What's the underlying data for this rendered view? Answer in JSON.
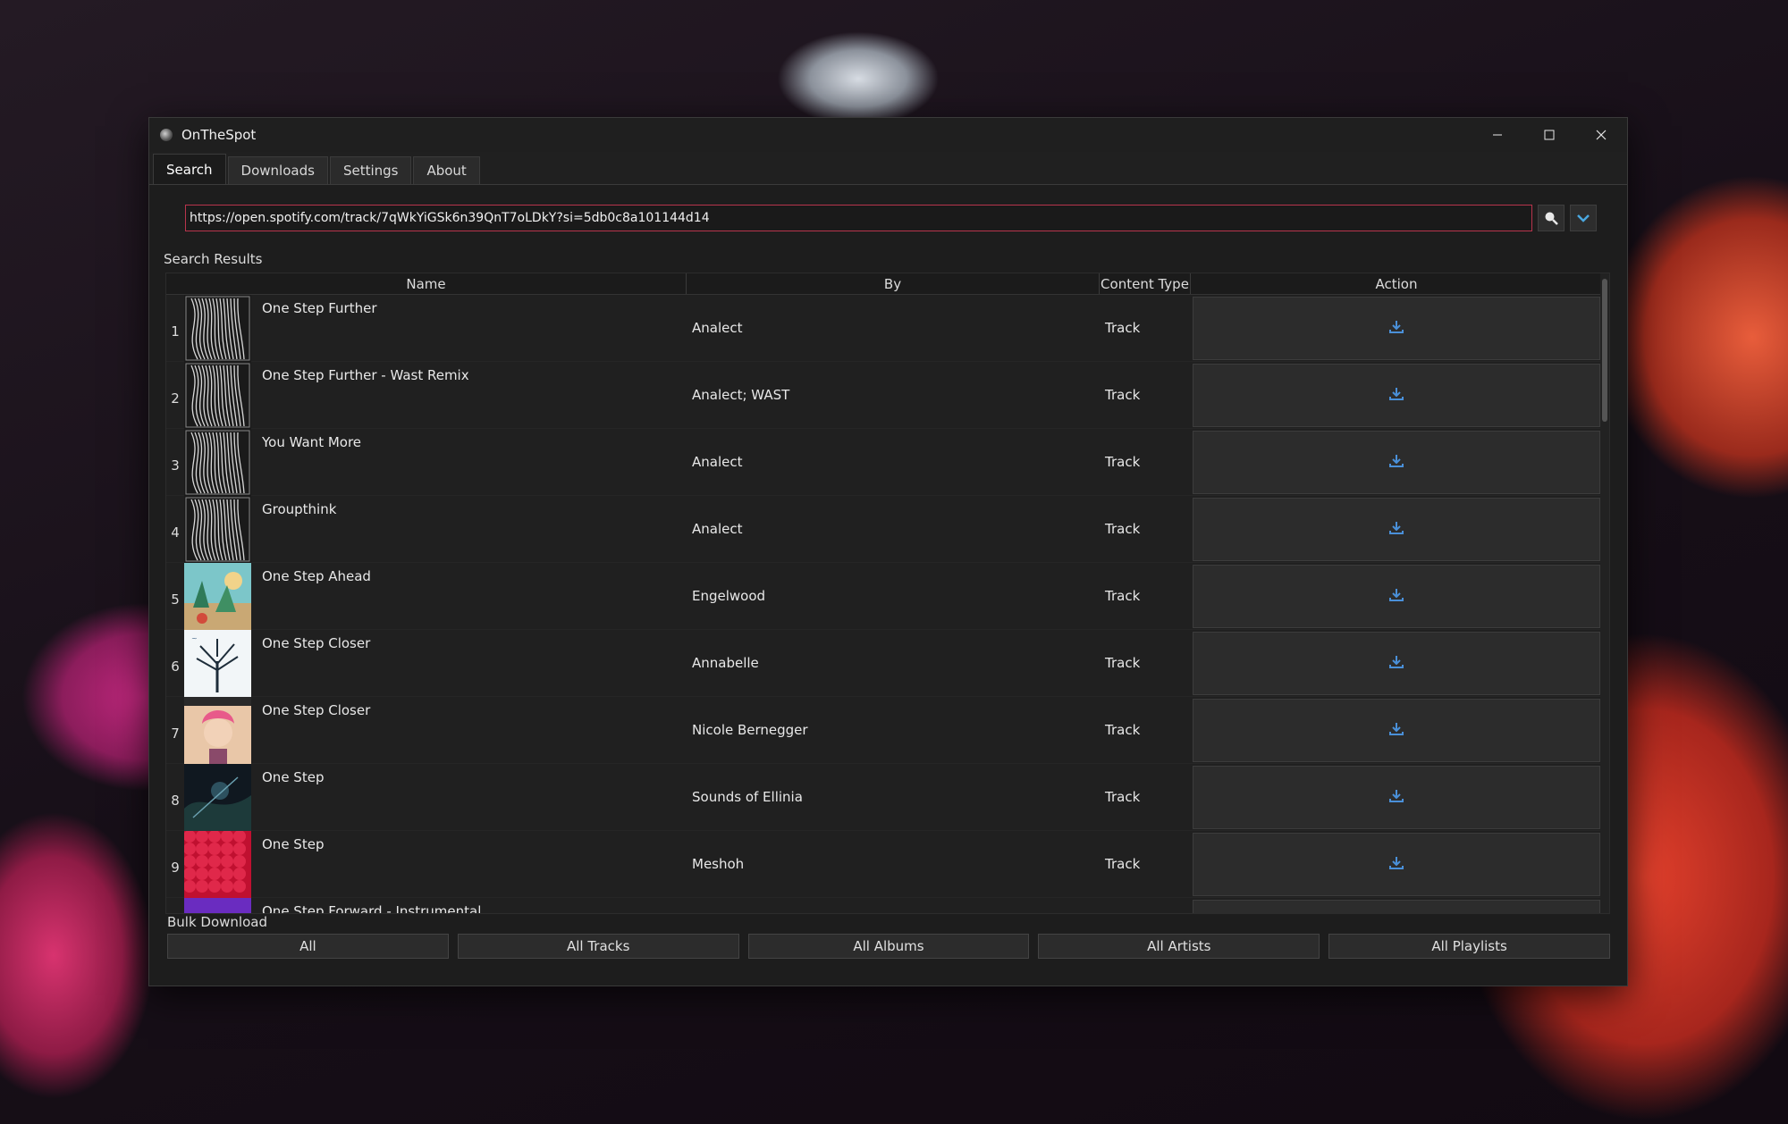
{
  "window": {
    "title": "OnTheSpot"
  },
  "tabs": [
    {
      "label": "Search",
      "active": true
    },
    {
      "label": "Downloads",
      "active": false
    },
    {
      "label": "Settings",
      "active": false
    },
    {
      "label": "About",
      "active": false
    }
  ],
  "search": {
    "value": "https://open.spotify.com/track/7qWkYiGSk6n39QnT7oLDkY?si=5db0c8a101144d14",
    "search_icon": "search-icon",
    "dropdown_icon": "chevron-down-icon"
  },
  "results": {
    "label": "Search Results",
    "columns": {
      "name": "Name",
      "by": "By",
      "type": "Content Type",
      "action": "Action"
    },
    "rows": [
      {
        "index": "1",
        "name": "One Step Further",
        "by": "Analect",
        "type": "Track",
        "art": "bw"
      },
      {
        "index": "2",
        "name": "One Step Further - Wast Remix",
        "by": "Analect; WAST",
        "type": "Track",
        "art": "bw"
      },
      {
        "index": "3",
        "name": "You Want More",
        "by": "Analect",
        "type": "Track",
        "art": "bw"
      },
      {
        "index": "4",
        "name": "Groupthink",
        "by": "Analect",
        "type": "Track",
        "art": "bw"
      },
      {
        "index": "5",
        "name": "One Step Ahead",
        "by": "Engelwood",
        "type": "Track",
        "art": "tropical"
      },
      {
        "index": "6",
        "name": "One Step Closer",
        "by": "Annabelle",
        "type": "Track",
        "art": "tree"
      },
      {
        "index": "7",
        "name": "One Step Closer",
        "by": "Nicole Bernegger",
        "type": "Track",
        "art": "singer"
      },
      {
        "index": "8",
        "name": "One Step",
        "by": "Sounds of Ellinia",
        "type": "Track",
        "art": "dark"
      },
      {
        "index": "9",
        "name": "One Step",
        "by": "Meshoh",
        "type": "Track",
        "art": "red"
      },
      {
        "index": "",
        "name": "One Step Forward - Instrumental",
        "by": "",
        "type": "",
        "art": "purple"
      }
    ]
  },
  "bulk": {
    "label": "Bulk Download",
    "buttons": [
      "All",
      "All Tracks",
      "All Albums",
      "All Artists",
      "All Playlists"
    ]
  },
  "colors": {
    "accent_border": "#b8344c",
    "download_icon": "#4a90d9"
  }
}
